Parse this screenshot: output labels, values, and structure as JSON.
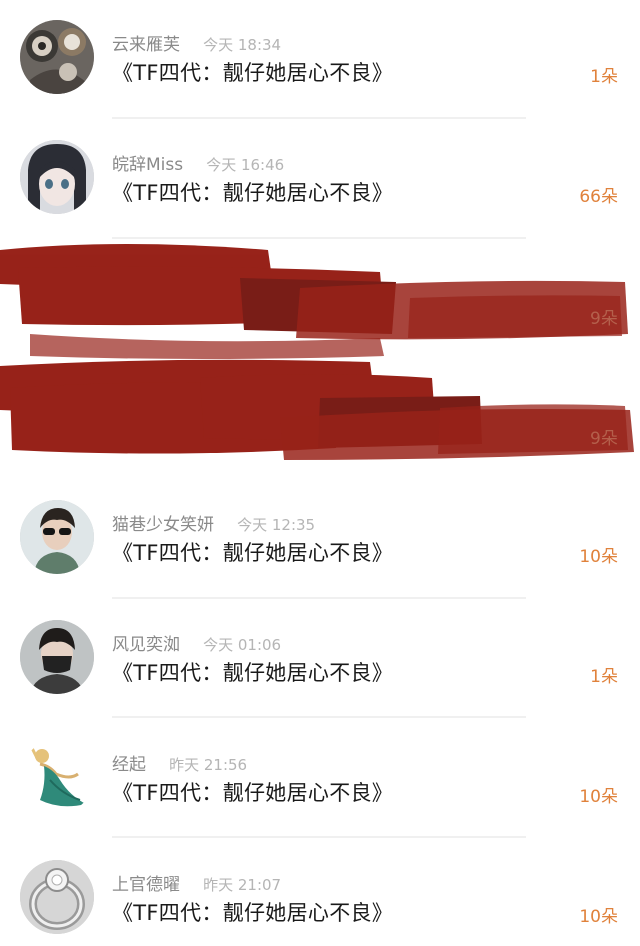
{
  "colors": {
    "accent": "#e0823c",
    "redaction": "#8f1006",
    "name": "#8a8a8a",
    "time": "#b5b5b5"
  },
  "feed": [
    {
      "name": "云来雁芙",
      "time": "今天 18:34",
      "title": "《TF四代：靓仔她居心不良》",
      "count": "1朵",
      "avatar": "gear-collage-avatar"
    },
    {
      "name": "皖辞Miss",
      "time": "今天 16:46",
      "title": "《TF四代：靓仔她居心不良》",
      "count": "66朵",
      "avatar": "anime-girl-avatar"
    },
    {
      "name": "猫巷少女笑妍",
      "time": "今天 12:35",
      "title": "《TF四代：靓仔她居心不良》",
      "count": "10朵",
      "avatar": "sunglasses-boy-avatar"
    },
    {
      "name": "风见奕洳",
      "time": "今天 01:06",
      "title": "《TF四代：靓仔她居心不良》",
      "count": "1朵",
      "avatar": "masked-boy-avatar"
    },
    {
      "name": "经起",
      "time": "昨天 21:56",
      "title": "《TF四代：靓仔她居心不良》",
      "count": "10朵",
      "avatar": "dancing-figure-avatar"
    },
    {
      "name": "上官德曜",
      "time": "昨天 21:07",
      "title": "《TF四代：靓仔她居心不良》",
      "count": "10朵",
      "avatar": "silver-ring-avatar"
    }
  ],
  "redacted": {
    "count_fragments": [
      "9朵",
      "9朵"
    ]
  }
}
